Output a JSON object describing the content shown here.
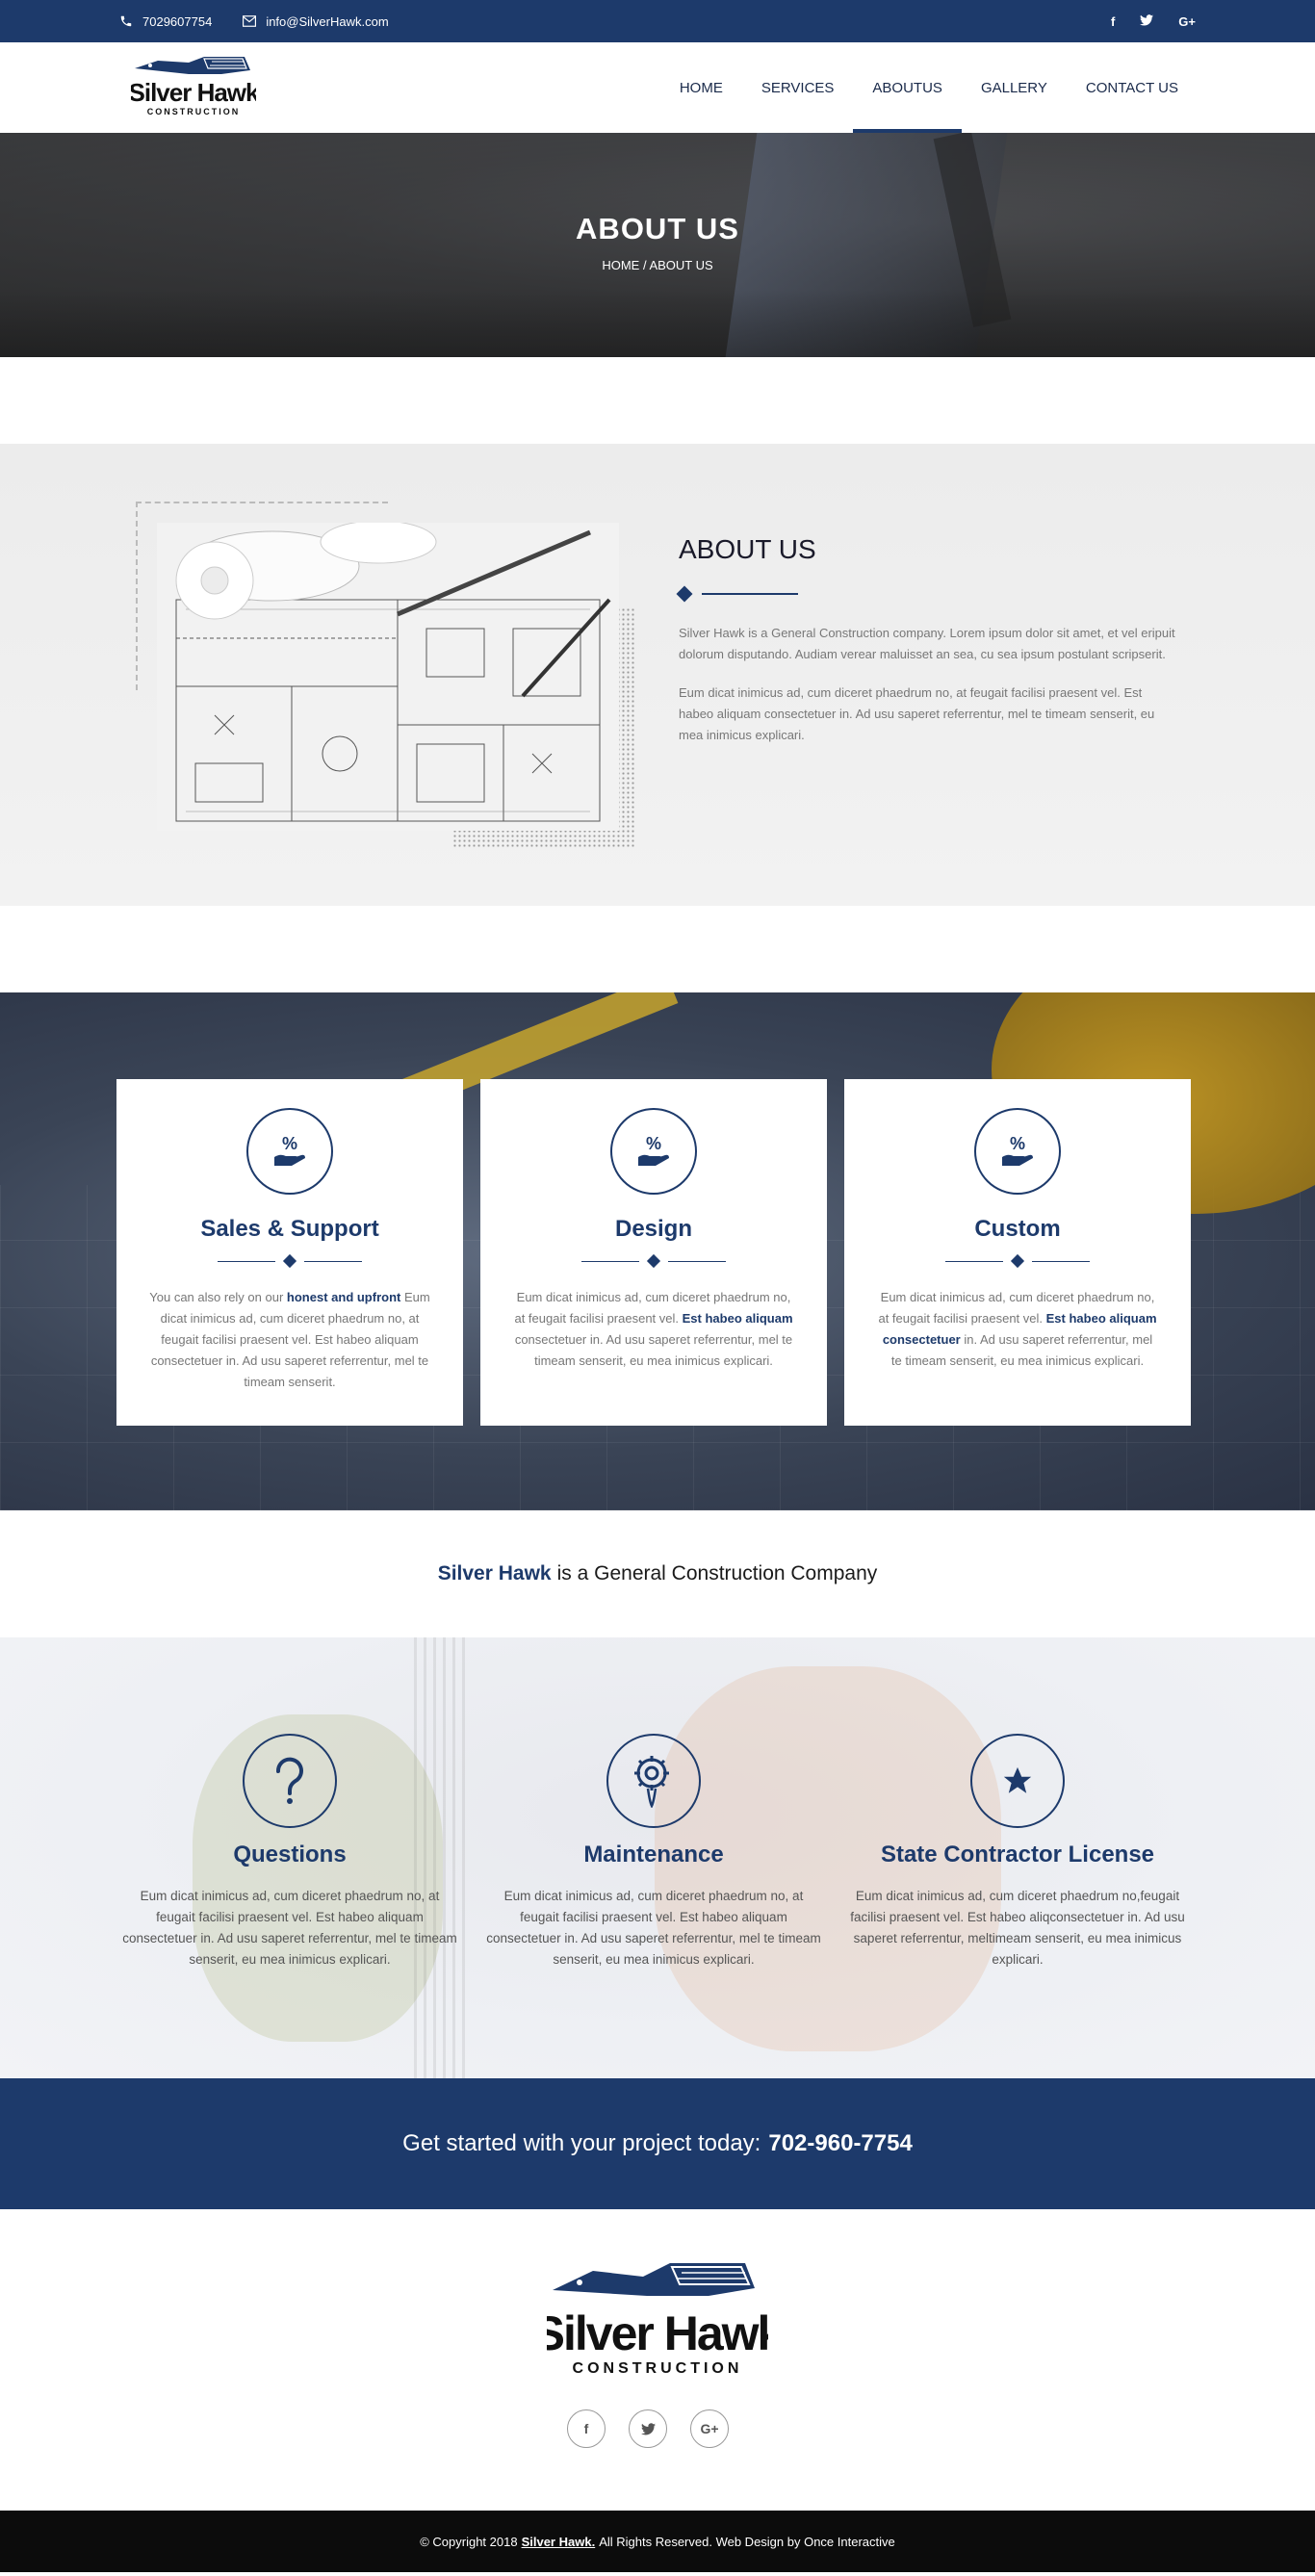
{
  "topbar": {
    "phone": "7029607754",
    "email": "info@SilverHawk.com",
    "socials": [
      "f",
      "t",
      "G+"
    ]
  },
  "brand": {
    "name": "Silver Hawk",
    "sub": "CONSTRUCTION",
    "color": "#1d3a6b"
  },
  "nav": {
    "items": [
      "HOME",
      "SERVICES",
      "ABOUTUS",
      "GALLERY",
      "CONTACT US"
    ],
    "active": "ABOUTUS"
  },
  "banner": {
    "title": "ABOUT US",
    "breadcrumb": "HOME / ABOUT US"
  },
  "about": {
    "heading": "ABOUT US",
    "p1": "Silver Hawk is a General Construction company. Lorem ipsum dolor sit amet, et vel eripuit dolorum disputando. Audiam verear maluisset an sea, cu sea ipsum postulant scripserit.",
    "p2": "Eum dicat inimicus ad, cum diceret phaedrum no, at feugait facilisi praesent vel. Est habeo aliquam consectetuer in. Ad usu saperet referrentur, mel te timeam senserit, eu mea inimicus explicari."
  },
  "features": [
    {
      "title": "Sales & Support",
      "pre": "You can also rely on our",
      "bold": "honest and upfront",
      "post": "Eum dicat inimicus ad, cum diceret phaedrum no, at feugait facilisi praesent vel. Est habeo aliquam consectetuer in. Ad usu saperet referrentur, mel te timeam senserit."
    },
    {
      "title": "Design",
      "pre": "Eum dicat inimicus ad, cum diceret phaedrum no, at feugait facilisi praesent vel.",
      "bold": "Est habeo aliquam",
      "post": "consectetuer in. Ad usu saperet referrentur, mel te timeam senserit, eu mea inimicus explicari."
    },
    {
      "title": "Custom",
      "pre": "Eum dicat inimicus ad, cum diceret phaedrum no, at feugait facilisi praesent vel.",
      "bold": "Est habeo aliquam consectetuer",
      "post": "in. Ad usu saperet referrentur, mel te timeam senserit, eu mea inimicus explicari."
    }
  ],
  "tagline": {
    "brand": "Silver Hawk",
    "rest": "is a General Construction Company"
  },
  "services": [
    {
      "title": "Questions",
      "icon": "question-icon",
      "text": "Eum dicat inimicus ad, cum diceret phaedrum no, at feugait facilisi praesent vel. Est habeo aliquam consectetuer in. Ad usu saperet referrentur, mel te timeam senserit, eu mea inimicus explicari."
    },
    {
      "title": "Maintenance",
      "icon": "gear-icon",
      "text": "Eum dicat inimicus ad, cum diceret phaedrum no, at feugait facilisi praesent vel. Est habeo aliquam consectetuer in. Ad usu saperet referrentur, mel te timeam senserit, eu mea inimicus explicari."
    },
    {
      "title": "State Contractor License",
      "icon": "star-icon",
      "text": "Eum dicat inimicus ad, cum diceret phaedrum no,feugait facilisi praesent vel. Est habeo aliqconsectetuer in. Ad usu saperet referrentur, meltimeam senserit, eu mea inimicus explicari."
    }
  ],
  "cta": {
    "text": "Get started with your project today:",
    "phone": "702-960-7754"
  },
  "footer": {
    "socials": [
      "f",
      "t",
      "G+"
    ],
    "copy_pre": "© Copyright 2018",
    "copy_link": "Silver Hawk.",
    "copy_post": "All Rights Reserved. Web Design by Once Interactive"
  }
}
